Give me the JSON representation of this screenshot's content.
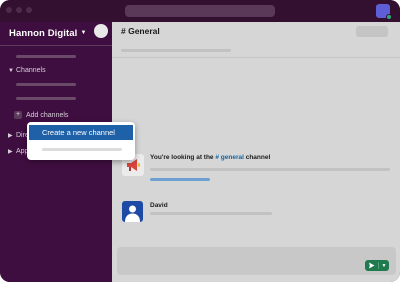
{
  "workspace": {
    "name": "Hannon Digital"
  },
  "sidebar": {
    "sections": [
      {
        "label": "Channels"
      },
      {
        "label": "Direct messages"
      },
      {
        "label": "Apps"
      }
    ],
    "add_channels_label": "Add channels"
  },
  "channel": {
    "title": "# General",
    "intro_prefix": "You're looking at the",
    "intro_channel": "# general",
    "intro_suffix": "channel"
  },
  "message": {
    "author": "David"
  },
  "dropdown": {
    "items": [
      {
        "label": "Create a new channel",
        "active": true
      }
    ]
  },
  "icons": {
    "workspace_chevron": "chevron-down-icon",
    "compose": "compose-icon",
    "megaphone": "megaphone-icon",
    "send": "send-icon",
    "send_options": "chevron-down-icon"
  },
  "colors": {
    "sidebar_bg": "#3f0e40",
    "menu_highlight": "#1e61a8",
    "channel_link": "#1264a3",
    "send_button": "#1f7a4e",
    "avatar_blue": "#1c4aa5"
  }
}
